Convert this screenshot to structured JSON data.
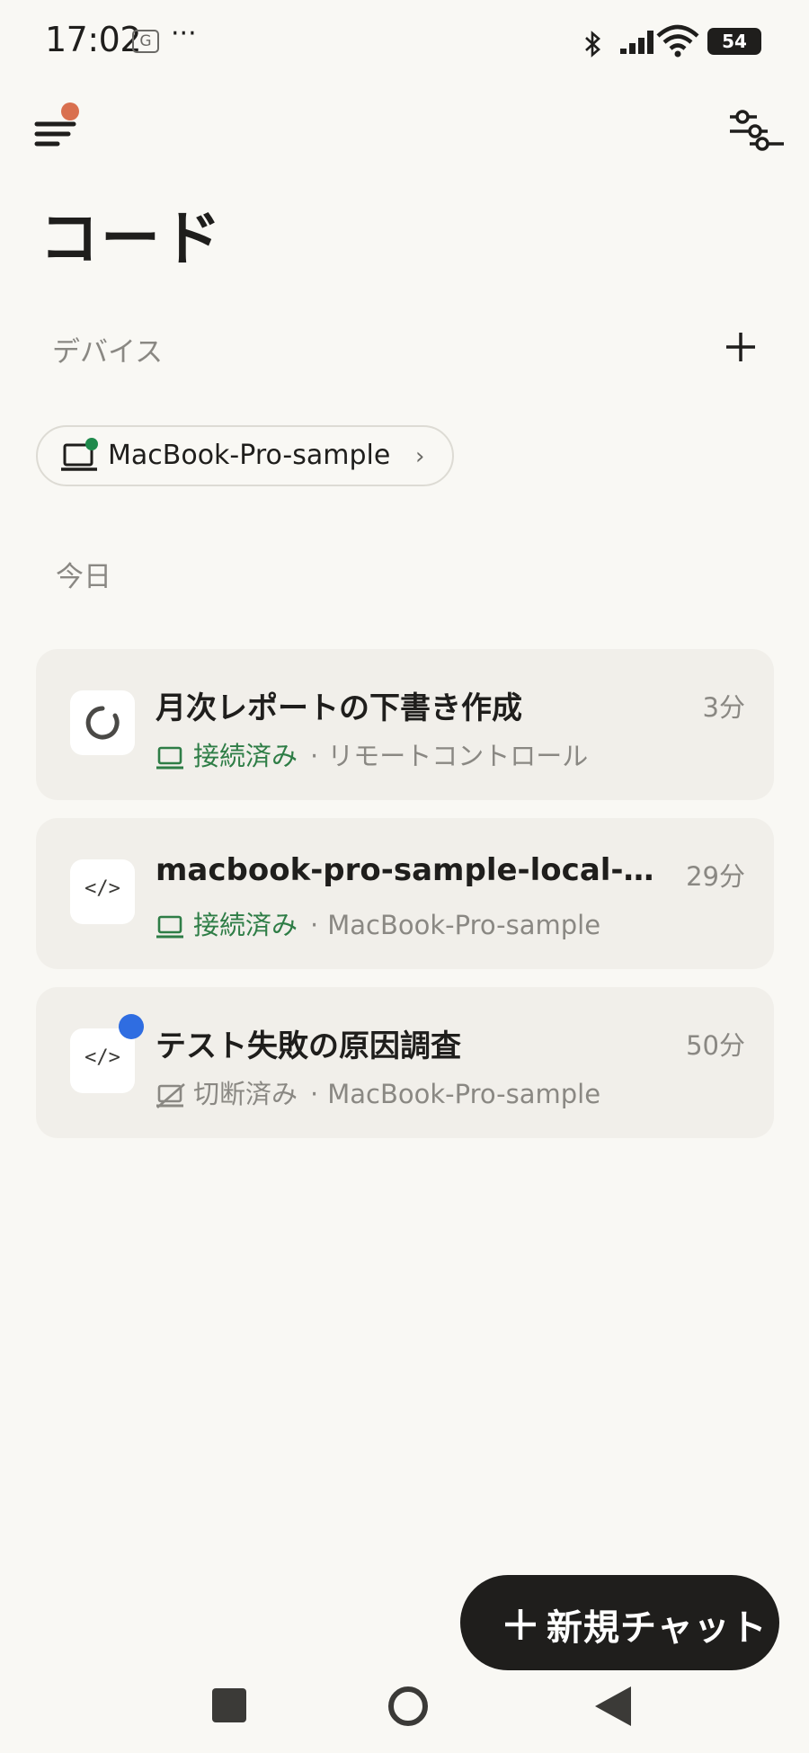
{
  "status_bar": {
    "time": "17:02",
    "g_badge": "G",
    "more": "···",
    "battery": "54"
  },
  "header": {
    "title": "コード"
  },
  "devices": {
    "section_label": "デバイス",
    "items": [
      {
        "name": "MacBook-Pro-sample",
        "online": true
      }
    ]
  },
  "today": {
    "section_label": "今日",
    "sessions": [
      {
        "title": "月次レポートの下書き作成",
        "time": "3分",
        "status": "接続済み",
        "subtitle": "リモートコントロール",
        "icon": "loading-spinner",
        "unread": false
      },
      {
        "title": "macbook-pro-sample-local-s…",
        "time": "29分",
        "status": "接続済み",
        "subtitle": "MacBook-Pro-sample",
        "icon": "code",
        "code_glyph": "</>",
        "unread": false
      },
      {
        "title": "テスト失敗の原因調査",
        "time": "50分",
        "status": "切断済み",
        "subtitle": "MacBook-Pro-sample",
        "icon": "code",
        "code_glyph": "</>",
        "unread": true
      }
    ],
    "separator": "·"
  },
  "fab": {
    "label": "新規チャット"
  },
  "colors": {
    "background": "#f9f8f4",
    "card": "#f1efea",
    "connected": "#2e7d46",
    "unread": "#2f6de1",
    "notification": "#d9704f",
    "fab": "#1f1e1c"
  }
}
